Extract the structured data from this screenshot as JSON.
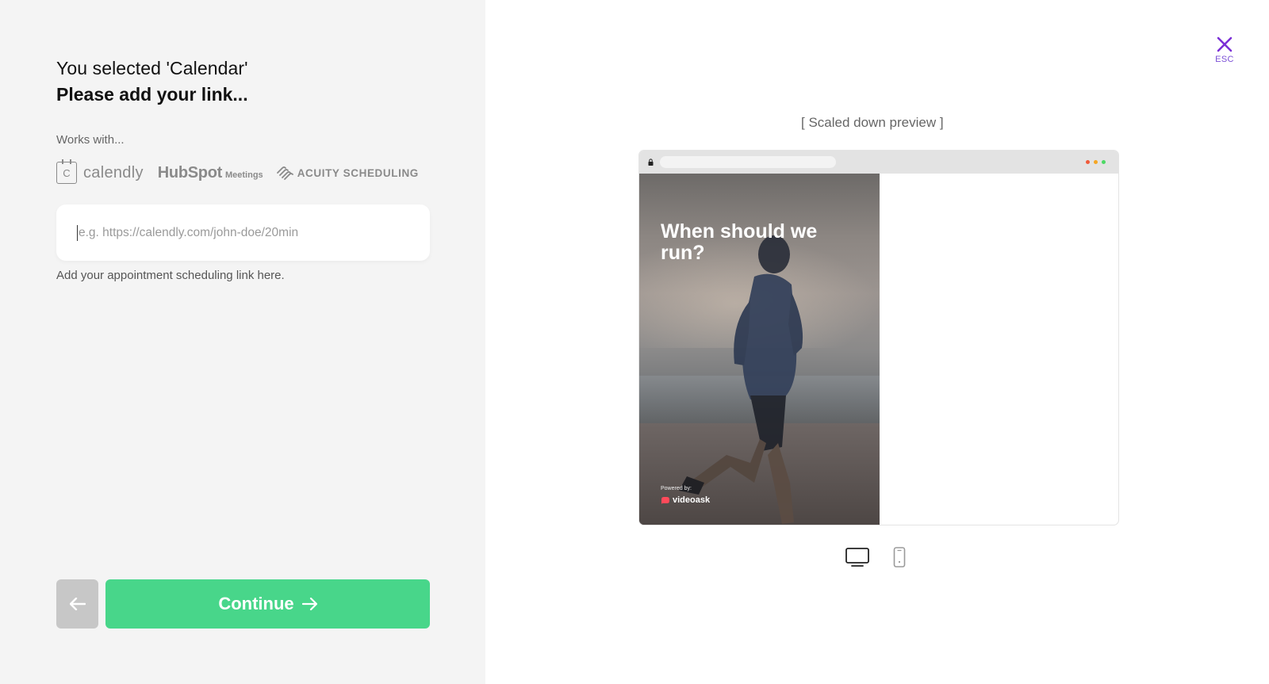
{
  "left": {
    "heading_line1": "You selected 'Calendar'",
    "heading_line2": "Please add your link...",
    "works_with": "Works with...",
    "logos": {
      "calendly_letter": "C",
      "calendly": "calendly",
      "hubspot": "HubSpot",
      "hubspot_suffix": "Meetings",
      "acuity": "ACUITY SCHEDULING"
    },
    "link_input": {
      "value": "",
      "placeholder": "e.g. https://calendly.com/john-doe/20min"
    },
    "helper": "Add your appointment scheduling link here.",
    "back_icon": "arrow-left-icon",
    "continue_label": "Continue",
    "continue_icon": "arrow-right-icon"
  },
  "right": {
    "close_icon": "close-icon",
    "esc_label": "ESC",
    "preview_label": "[ Scaled down preview ]",
    "video": {
      "title": "When should we run?",
      "powered_by": "Powered by:",
      "brand": "videoask"
    },
    "devices": [
      {
        "name": "desktop",
        "icon": "desktop-icon",
        "selected": true
      },
      {
        "name": "mobile",
        "icon": "mobile-icon",
        "selected": false
      }
    ]
  },
  "colors": {
    "accent_green": "#48d68a",
    "accent_purple": "#7b4fd6",
    "back_gray": "#c7c7c7",
    "panel_bg": "#f4f4f4"
  }
}
